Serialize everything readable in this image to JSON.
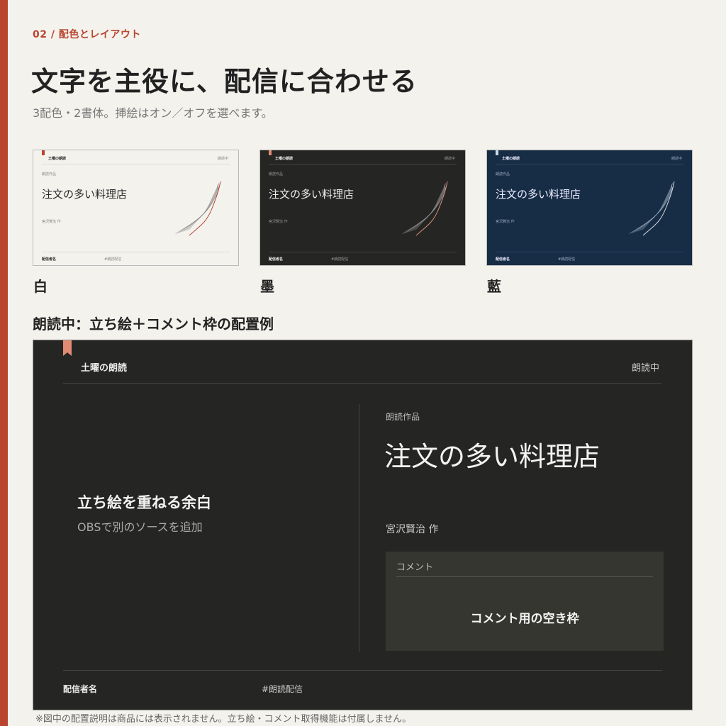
{
  "section_label": "02 / 配色とレイアウト",
  "heading": "文字を主役に、配信に合わせる",
  "subheading": "3配色・2書体。挿絵はオン／オフを選べます。",
  "colors": {
    "accent": "#b9452f",
    "ribbon": "#e08b72"
  },
  "themes": [
    {
      "name": "白",
      "bg": "#f4f2ed",
      "fg": "#2a2a2a",
      "muted": "#888",
      "rule": "#ddd",
      "line": "#b9452f",
      "ribbon": "#b9452f",
      "header": "土曜の朗読",
      "status": "朗読中",
      "kicker": "朗読作品",
      "title": "注文の多い料理店",
      "author": "宮沢賢治 作",
      "footer_left": "配信者名",
      "footer_right": "#朗読配信"
    },
    {
      "name": "墨",
      "bg": "#252524",
      "fg": "#eee",
      "muted": "#999",
      "rule": "#444",
      "line": "#d9957a",
      "ribbon": "#e08b72",
      "header": "土曜の朗読",
      "status": "朗読中",
      "kicker": "朗読作品",
      "title": "注文の多い料理店",
      "author": "宮沢賢治 作",
      "footer_left": "配信者名",
      "footer_right": "#朗読配信"
    },
    {
      "name": "藍",
      "bg": "#172c45",
      "fg": "#eef",
      "muted": "#9ab",
      "rule": "#2d4560",
      "line": "#d8dde4",
      "ribbon": "#c8d8e4",
      "header": "土曜の朗読",
      "status": "朗読中",
      "kicker": "朗読作品",
      "title": "注文の多い料理店",
      "author": "宮沢賢治 作",
      "footer_left": "配信者名",
      "footer_right": "#朗読配信"
    }
  ],
  "example": {
    "section_title": "朗読中：立ち絵＋コメント枠の配置例",
    "header": "土曜の朗読",
    "status": "朗読中",
    "placeholder_title": "立ち絵を重ねる余白",
    "placeholder_sub": "OBSで別のソースを追加",
    "kicker": "朗読作品",
    "title": "注文の多い料理店",
    "author": "宮沢賢治 作",
    "comment_label": "コメント",
    "comment_empty": "コメント用の空き枠",
    "footer_left": "配信者名",
    "footer_right": "#朗読配信"
  },
  "footnote": "※図中の配置説明は商品には表示されません。立ち絵・コメント取得機能は付属しません。"
}
